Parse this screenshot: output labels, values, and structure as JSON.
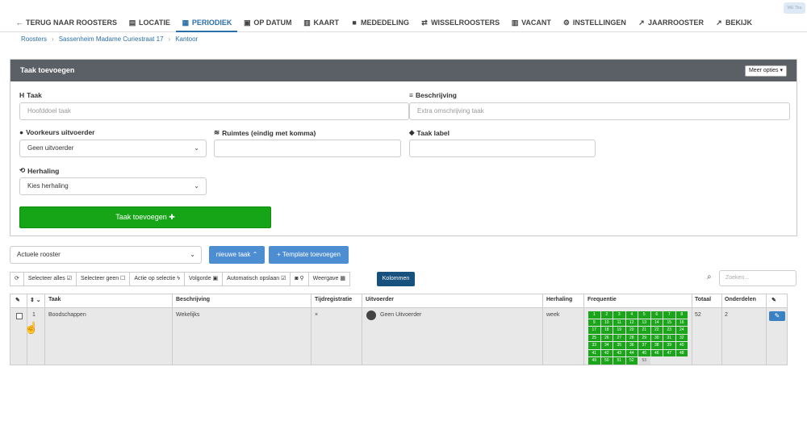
{
  "nav": {
    "items": [
      {
        "icon": "←",
        "label": "TERUG NAAR ROOSTERS"
      },
      {
        "icon": "▤",
        "label": "LOCATIE"
      },
      {
        "icon": "▦",
        "label": "PERIODIEK"
      },
      {
        "icon": "▣",
        "label": "OP DATUM"
      },
      {
        "icon": "▥",
        "label": "KAART"
      },
      {
        "icon": "■",
        "label": "MEDEDELING"
      },
      {
        "icon": "⇄",
        "label": "WISSELROOSTERS"
      },
      {
        "icon": "▥",
        "label": "VACANT"
      },
      {
        "icon": "⚙",
        "label": "INSTELLINGEN"
      },
      {
        "icon": "↗",
        "label": "JAARROOSTER"
      },
      {
        "icon": "↗",
        "label": "BEKIJK"
      }
    ],
    "badge": "WE Tbu"
  },
  "breadcrumb": [
    "Roosters",
    "Sassenheim Madame Curiestraat 17",
    "Kantoor"
  ],
  "panel": {
    "title": "Taak toevoegen",
    "meer_opties": "Meer opties ▾",
    "taak_label": "Taak",
    "taak_placeholder": "Hoofddoel taak",
    "beschrijving_label": "Beschrijving",
    "beschrijving_placeholder": "Extra omschrijving taak",
    "voorkeur_label": "Voorkeurs uitvoerder",
    "voorkeur_value": "Geen uitvoerder",
    "ruimtes_label": "Ruimtes (eindig met komma)",
    "tag_label": "Taak label",
    "herhaling_label": "Herhaling",
    "herhaling_value": "Kies herhaling",
    "add_button": "Taak toevoegen ✚"
  },
  "controls": {
    "rooster_select": "Actuele rooster",
    "nieuwe_taak": "nieuwe taak ⌃",
    "template": "+ Template toevoegen",
    "toolbar": [
      "⟳",
      "Selecteer alles ☑",
      "Selecteer geen ☐",
      "Actie op selectie ϟ",
      "Volgorde ▣",
      "Automatisch opslaan ☑",
      "◙ ⚲",
      "Weergave ▦"
    ],
    "kolommen": "Kolommen",
    "search_placeholder": "Zoeken..."
  },
  "table": {
    "headers": [
      "✎",
      "⇕ ⌄",
      "Taak",
      "Beschrijving",
      "Tijdregistratie",
      "Uitvoerder",
      "Herhaling",
      "Frequentie",
      "Totaal",
      "Onderdelen",
      "✎"
    ],
    "row": {
      "nr": "1",
      "taak": "Boodschappen",
      "beschrijving": "Wekelijks",
      "tijdregistratie": "×",
      "uitvoerder": "Geen Uitvoerder",
      "herhaling": "week",
      "totaal": "52",
      "onderdelen": "2"
    },
    "weeks": [
      "1",
      "2",
      "3",
      "4",
      "5",
      "6",
      "7",
      "8",
      "9",
      "10",
      "11",
      "12",
      "13",
      "14",
      "15",
      "16",
      "17",
      "18",
      "19",
      "20",
      "21",
      "22",
      "23",
      "24",
      "25",
      "26",
      "27",
      "28",
      "29",
      "30",
      "31",
      "32",
      "33",
      "34",
      "35",
      "36",
      "37",
      "38",
      "39",
      "40",
      "41",
      "42",
      "43",
      "44",
      "45",
      "46",
      "47",
      "48",
      "49",
      "50",
      "51",
      "52",
      "53"
    ]
  }
}
